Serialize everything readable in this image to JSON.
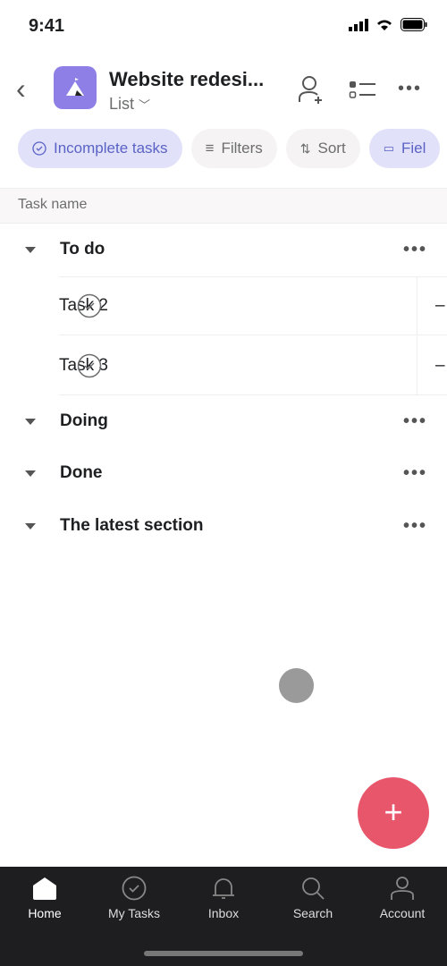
{
  "status_bar": {
    "time": "9:41"
  },
  "header": {
    "title": "Website redesi...",
    "view": "List"
  },
  "chips": [
    {
      "label": "Incomplete tasks",
      "icon": "check-circle-icon",
      "active": true
    },
    {
      "label": "Filters",
      "icon": "filter-icon"
    },
    {
      "label": "Sort",
      "icon": "sort-icon"
    },
    {
      "label": "Fiel",
      "icon": "fields-icon",
      "active": true
    }
  ],
  "column_header": "Task name",
  "sections": [
    {
      "name": "To do",
      "tasks": [
        {
          "name": "Task 2",
          "value": "–"
        },
        {
          "name": "Task 3",
          "value": "–"
        }
      ]
    },
    {
      "name": "Doing"
    },
    {
      "name": "Done"
    },
    {
      "name": "The latest section"
    }
  ],
  "tabbar": [
    "Home",
    "My Tasks",
    "Inbox",
    "Search",
    "Account"
  ],
  "colors": {
    "accent": "#8d7fe6",
    "fab": "#e8566c",
    "tabbar": "#1e1d20"
  }
}
